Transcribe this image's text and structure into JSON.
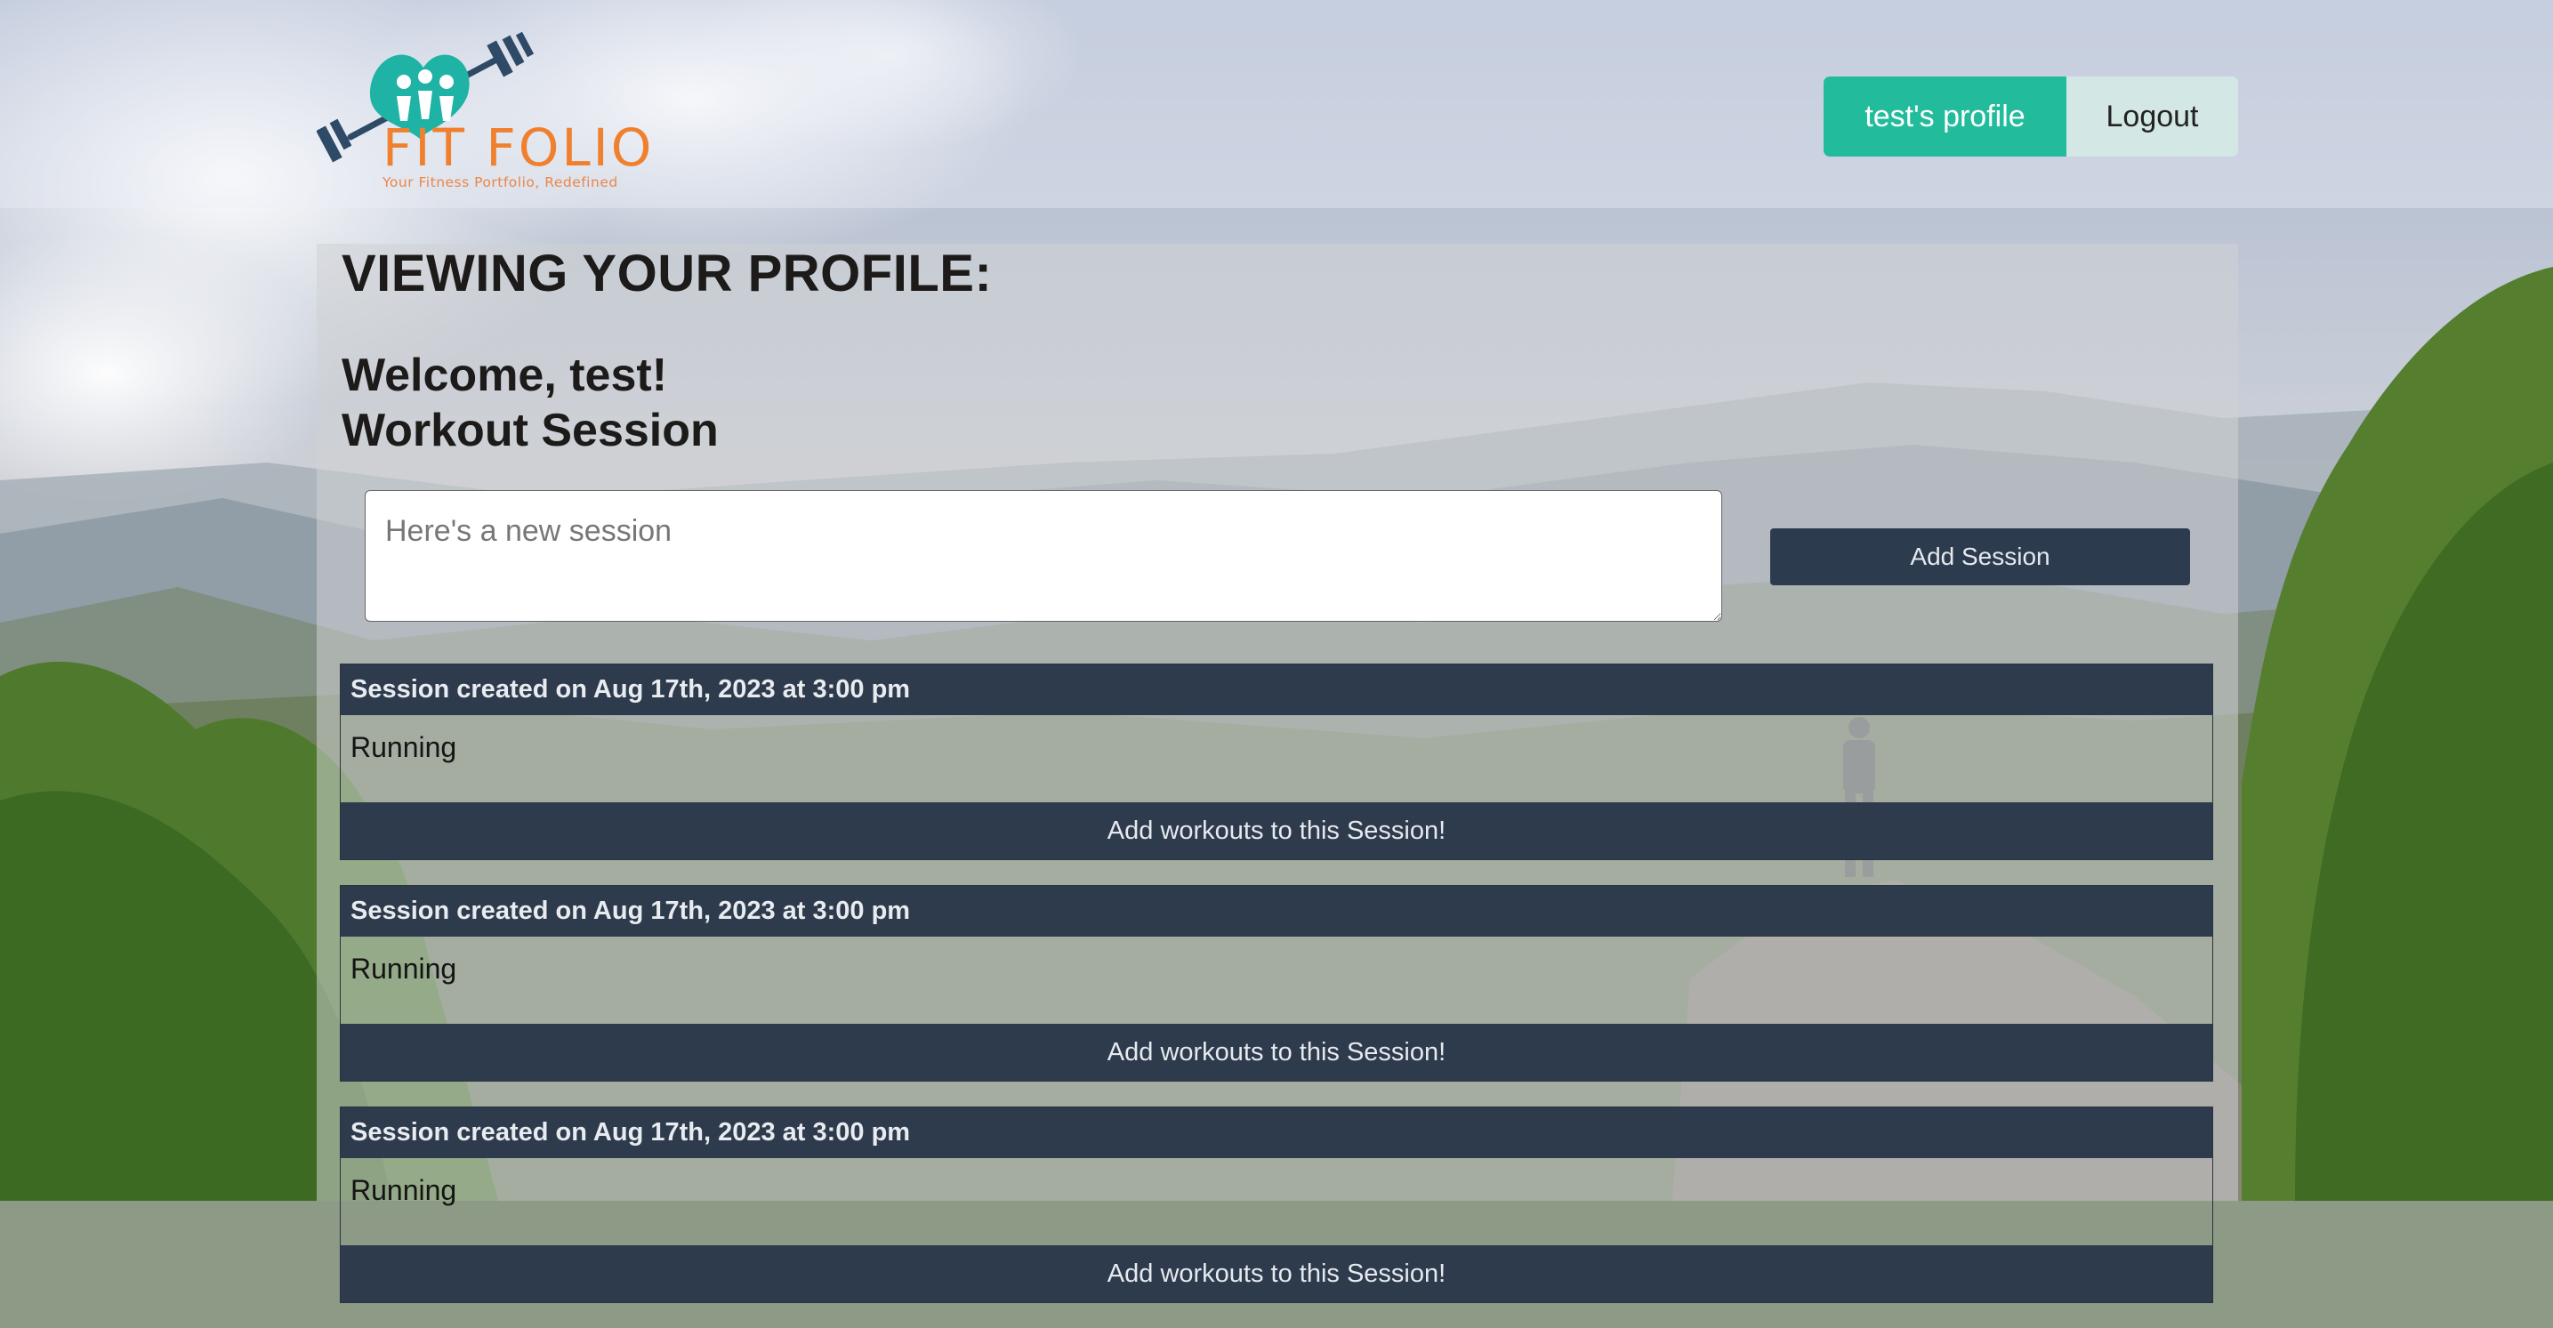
{
  "brand": {
    "name": "FIT FOLIO",
    "tagline": "Your Fitness Portfolio, Redefined",
    "colors": {
      "teal": "#22bc9c",
      "orange": "#f07f2e",
      "navy": "#2d3b4d"
    }
  },
  "nav": {
    "profile_label": "test's profile",
    "logout_label": "Logout"
  },
  "page": {
    "heading": "VIEWING YOUR PROFILE:",
    "welcome": "Welcome, test!",
    "section_title": "Workout Session"
  },
  "new_session": {
    "placeholder": "Here's a new session",
    "value": "",
    "button_label": "Add Session"
  },
  "sessions": [
    {
      "header": "Session created on Aug 17th, 2023 at 3:00 pm",
      "body": "Running",
      "button_label": "Add workouts to this Session!"
    },
    {
      "header": "Session created on Aug 17th, 2023 at 3:00 pm",
      "body": "Running",
      "button_label": "Add workouts to this Session!"
    },
    {
      "header": "Session created on Aug 17th, 2023 at 3:00 pm",
      "body": "Running",
      "button_label": "Add workouts to this Session!"
    }
  ]
}
